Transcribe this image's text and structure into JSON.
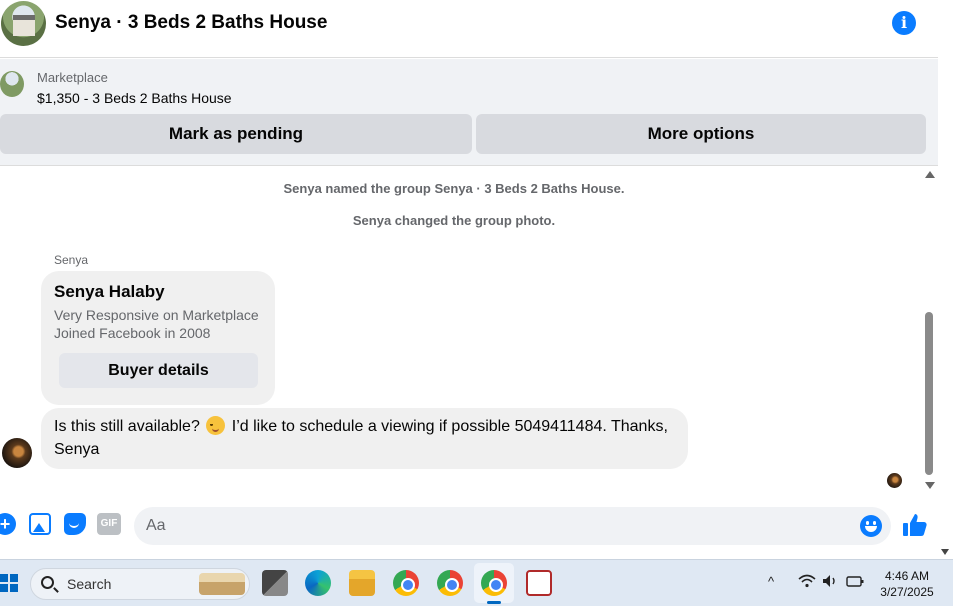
{
  "header": {
    "title": "Senya · 3 Beds 2 Baths House",
    "info_glyph": "i"
  },
  "listing": {
    "source": "Marketplace",
    "price_title": "$1,350 - 3 Beds 2 Baths House",
    "mark_pending_label": "Mark as pending",
    "more_options_label": "More options"
  },
  "messages": {
    "system": [
      "Senya named the group Senya · 3 Beds 2 Baths House.",
      "Senya changed the group photo."
    ],
    "sender_name": "Senya",
    "profile_card": {
      "name": "Senya Halaby",
      "line1": "Very Responsive on Marketplace",
      "line2": "Joined Facebook in 2008",
      "button_label": "Buyer details"
    },
    "bubble": {
      "text_before_emoji": "Is this still available?",
      "emoji": "smiling-face-emoji",
      "text_after_emoji": "I’d like to schedule a viewing if possible 5049411484. Thanks, Senya"
    }
  },
  "composer": {
    "placeholder": "Aa",
    "gif_label": "GIF",
    "plus_glyph": "+"
  },
  "taskbar": {
    "search_label": "Search",
    "time": "4:46 AM",
    "date": "3/27/2025",
    "tray_caret": "^"
  },
  "colors": {
    "accent": "#0a7cff",
    "panel_bg": "#f0f2f5",
    "button_bg": "#d8dadf",
    "bubble_bg": "#f0f0f0",
    "taskbar_bg": "#dfe8f3"
  }
}
